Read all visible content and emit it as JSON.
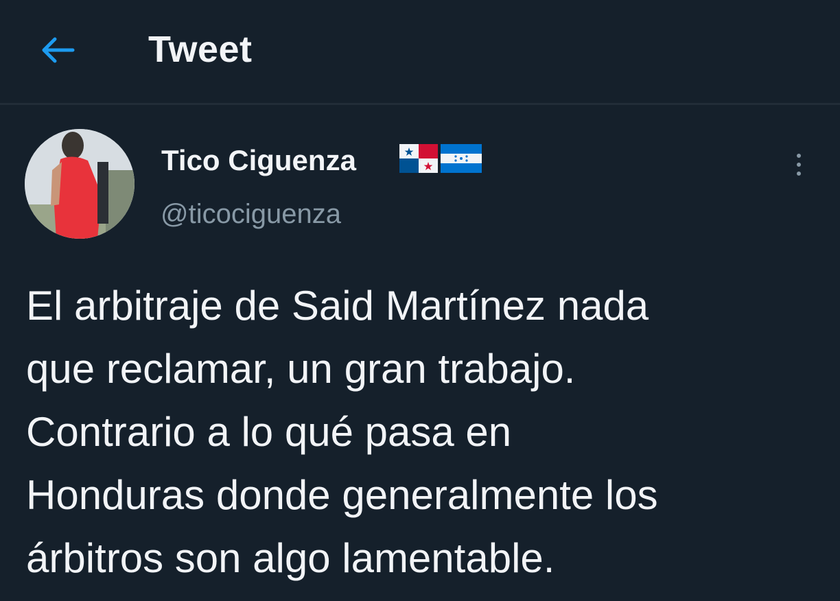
{
  "header": {
    "title": "Tweet",
    "back_icon": "arrow-left-icon",
    "accent_color": "#1d9bf0"
  },
  "tweet": {
    "author": {
      "display_name": "Tico Ciguenza",
      "handle": "@ticociguenza",
      "flag_icons": [
        "panama-flag-icon",
        "honduras-flag-icon"
      ]
    },
    "more_icon": "more-vertical-icon",
    "text_lines": [
      "El arbitraje de Said Martínez nada",
      "que reclamar, un gran trabajo.",
      "Contrario a lo qué pasa en",
      "Honduras donde generalmente los",
      "árbitros son algo lamentable."
    ]
  },
  "colors": {
    "background": "#15202b",
    "primary_text": "#f2f4f7",
    "secondary_text": "#8899a6"
  }
}
